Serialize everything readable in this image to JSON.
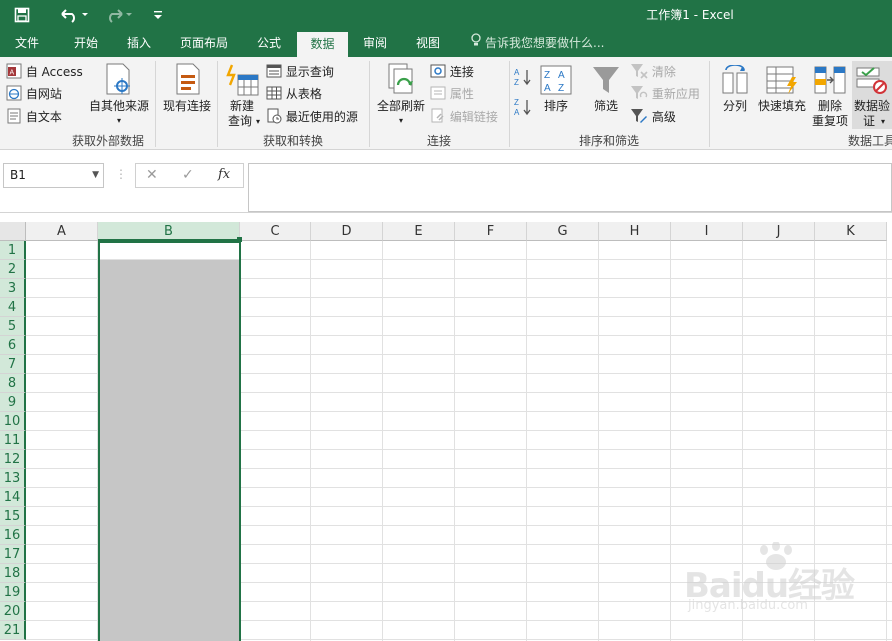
{
  "window": {
    "title": "工作簿1 - Excel"
  },
  "tabs": [
    "文件",
    "开始",
    "插入",
    "页面布局",
    "公式",
    "数据",
    "审阅",
    "视图"
  ],
  "active_tab": "数据",
  "tell_me": "告诉我您想要做什么...",
  "ribbon": {
    "get_external": {
      "label": "获取外部数据",
      "access": "自 Access",
      "web": "自网站",
      "text": "自文本",
      "other": "自其他来源",
      "existing": "现有连接"
    },
    "get_transform": {
      "label": "获取和转换",
      "new_query_1": "新建",
      "new_query_2": "查询",
      "show_queries": "显示查询",
      "from_table": "从表格",
      "recent": "最近使用的源"
    },
    "connections": {
      "label": "连接",
      "refresh_all": "全部刷新",
      "connections": "连接",
      "properties": "属性",
      "edit_links": "编辑链接"
    },
    "sort_filter": {
      "label": "排序和筛选",
      "sort": "排序",
      "filter": "筛选",
      "clear": "清除",
      "reapply": "重新应用",
      "advanced": "高级"
    },
    "data_tools": {
      "label": "数据工具",
      "text_to_columns": "分列",
      "flash_fill": "快速填充",
      "remove_dup_1": "删除",
      "remove_dup_2": "重复项",
      "validation_1": "数据验",
      "validation_2": "证"
    }
  },
  "formula_bar": {
    "name_box": "B1",
    "fx": "fx",
    "value": ""
  },
  "columns": [
    "A",
    "B",
    "C",
    "D",
    "E",
    "F",
    "G",
    "H",
    "I",
    "J",
    "K"
  ],
  "selected_column": "B",
  "rows": [
    "1",
    "2",
    "3",
    "4",
    "5",
    "6",
    "7",
    "8",
    "9",
    "10",
    "11",
    "12",
    "13",
    "14",
    "15",
    "16",
    "17",
    "18",
    "19",
    "20",
    "21"
  ],
  "colors": {
    "brand": "#217346",
    "selection_fill": "#c6c6c6"
  },
  "watermark": {
    "main": "Baidu经验",
    "sub": "jingyan.baidu.com"
  }
}
